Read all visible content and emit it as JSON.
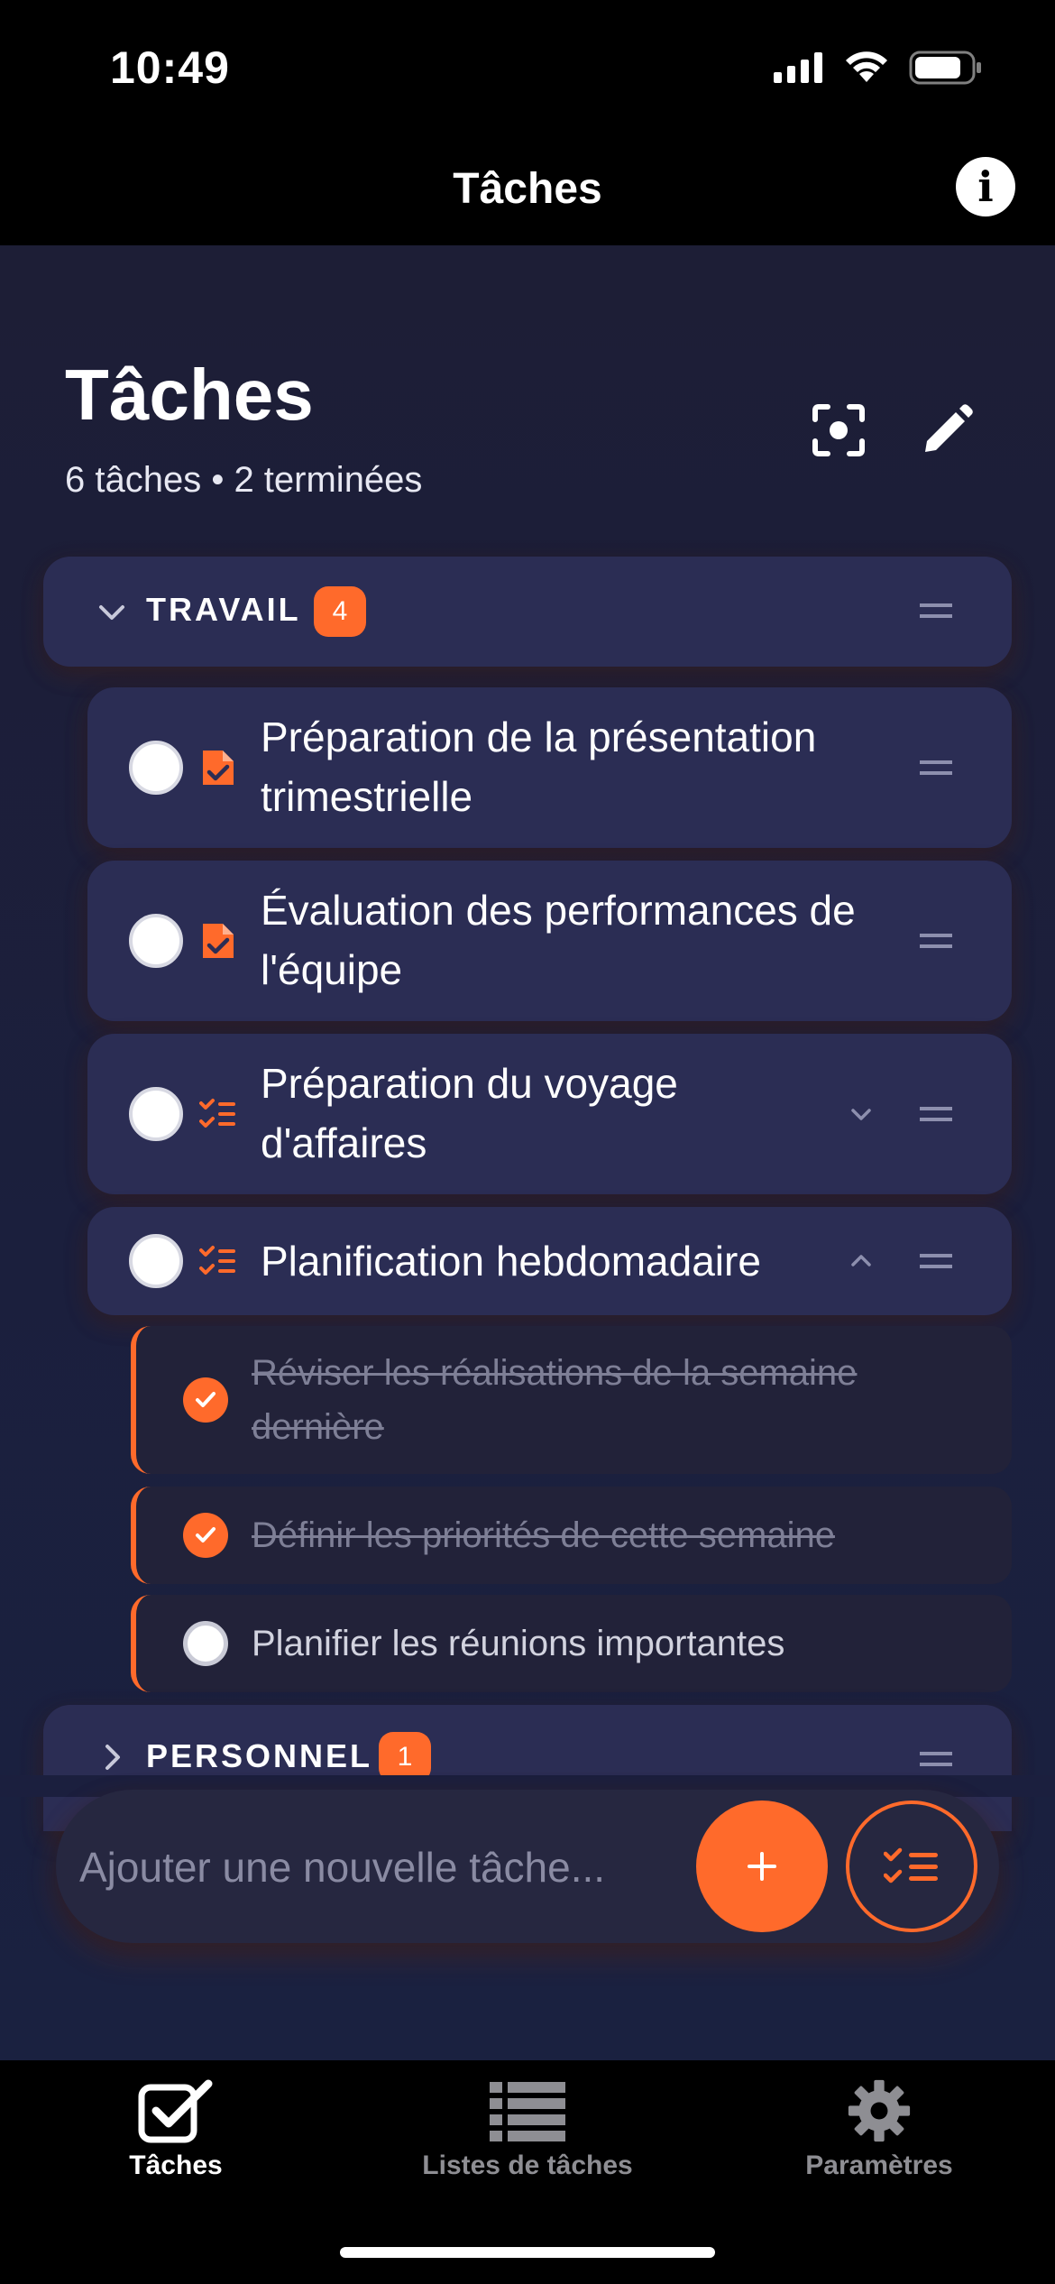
{
  "status_bar": {
    "time": "10:49"
  },
  "nav": {
    "title": "Tâches",
    "info_icon": "info-icon"
  },
  "header": {
    "title": "Tâches",
    "subtitle": "6 tâches • 2 terminées",
    "focus_icon": "focus-icon",
    "edit_icon": "pencil-icon"
  },
  "groups": [
    {
      "name": "TRAVAIL",
      "count": "4",
      "expanded": true,
      "tasks": [
        {
          "label": "Préparation de la présentation trimestrielle",
          "type": "document",
          "completed": false
        },
        {
          "label": "Évaluation des performances de l'équipe",
          "type": "document",
          "completed": false
        },
        {
          "label": "Préparation du voyage d'affaires",
          "type": "checklist",
          "completed": false,
          "expandable": true,
          "expanded": false
        },
        {
          "label": "Planification hebdomadaire",
          "type": "checklist",
          "completed": false,
          "expandable": true,
          "expanded": true,
          "subtasks": [
            {
              "label": "Réviser les réalisations de la semaine dernière",
              "completed": true
            },
            {
              "label": "Définir les priorités de cette semaine",
              "completed": true
            },
            {
              "label": "Planifier les réunions importantes",
              "completed": false
            }
          ]
        }
      ]
    },
    {
      "name": "PERSONNEL",
      "count": "1",
      "expanded": false
    }
  ],
  "add_task": {
    "placeholder": "Ajouter une nouvelle tâche..."
  },
  "tabs": [
    {
      "label": "Tâches",
      "icon": "checkbox-icon",
      "active": true
    },
    {
      "label": "Listes de tâches",
      "icon": "list-icon",
      "active": false
    },
    {
      "label": "Paramètres",
      "icon": "gear-icon",
      "active": false
    }
  ],
  "colors": {
    "accent": "#ff6a2b",
    "card": "#2b2d54",
    "background": "#1d1e36",
    "inactive_tab": "#8e8e93"
  }
}
